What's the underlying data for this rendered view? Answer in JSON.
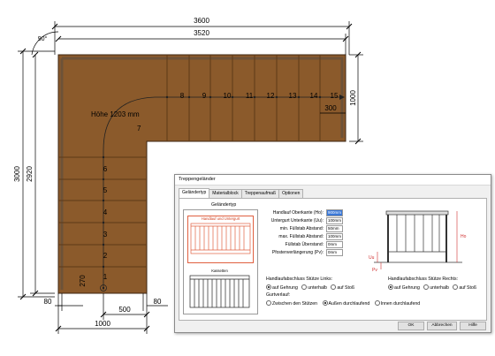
{
  "drawing": {
    "dim_top_outer": "3600",
    "dim_top_inner": "3520",
    "dim_left_outer": "3000",
    "dim_left_inner": "2920",
    "dim_right_height": "1000",
    "dim_small_300": "300",
    "angle_label": "90°",
    "height_label": "Höhe 1203 mm",
    "dim_bottom_left_80": "80",
    "dim_bottom_500": "500",
    "dim_bottom_right_80": "80",
    "dim_bottom_1000": "1000",
    "dim_270": "270",
    "landing_number": "7",
    "top_steps": [
      "8",
      "9",
      "10",
      "11",
      "12",
      "13",
      "14",
      "15"
    ],
    "left_steps": [
      "6",
      "5",
      "4",
      "3",
      "2",
      "1"
    ],
    "colors": {
      "wood": "#8b5a2b",
      "wood_dark": "#5e3a17",
      "dim_line": "#000000"
    }
  },
  "dialog": {
    "title": "Treppengeländer",
    "tabs": [
      "Geländertyp",
      "Materialblock",
      "Treppenaufmaß",
      "Optionen"
    ],
    "active_tab": 0,
    "section_label": "Geländertyp",
    "list_items": [
      {
        "caption": "Handlauf und Untergurt",
        "selected": true
      },
      {
        "caption": "Kassetten",
        "selected": false
      }
    ],
    "fields": [
      {
        "label": "Handlauf Oberkante (Ho):",
        "value": "900mm",
        "selected": true
      },
      {
        "label": "Untergurt Unterkante (Uu):",
        "value": "100mm",
        "selected": false
      },
      {
        "label": "min. Füllstab Abstand:",
        "value": "50mm",
        "selected": false
      },
      {
        "label": "max. Füllstab Abstand:",
        "value": "100mm",
        "selected": false
      },
      {
        "label": "Füllstab Überstand:",
        "value": "0mm",
        "selected": false
      },
      {
        "label": "Pfostenverlängerung (Pv):",
        "value": "0mm",
        "selected": false
      }
    ],
    "left_end_label": "Handlaufabschluss Stütze Links:",
    "left_end_options": [
      "auf Gehrung",
      "unterhalb",
      "auf Stoß"
    ],
    "left_end_selected": 0,
    "right_end_label": "Handlaufabschluss Stütze Rechts:",
    "right_end_options": [
      "auf Gehrung",
      "unterhalb",
      "auf Stoß"
    ],
    "right_end_selected": 0,
    "gurt_label": "Gurtverlauf:",
    "gurt_options": [
      "Zwischen den Stützen",
      "Außen durchlaufend",
      "Innen durchlaufend"
    ],
    "gurt_selected": 1,
    "preview_labels": {
      "ho": "Ho",
      "uu": "Uu",
      "pv": "Pv"
    },
    "buttons": {
      "ok": "OK",
      "cancel": "Abbrechen",
      "help": "Hilfe"
    }
  }
}
